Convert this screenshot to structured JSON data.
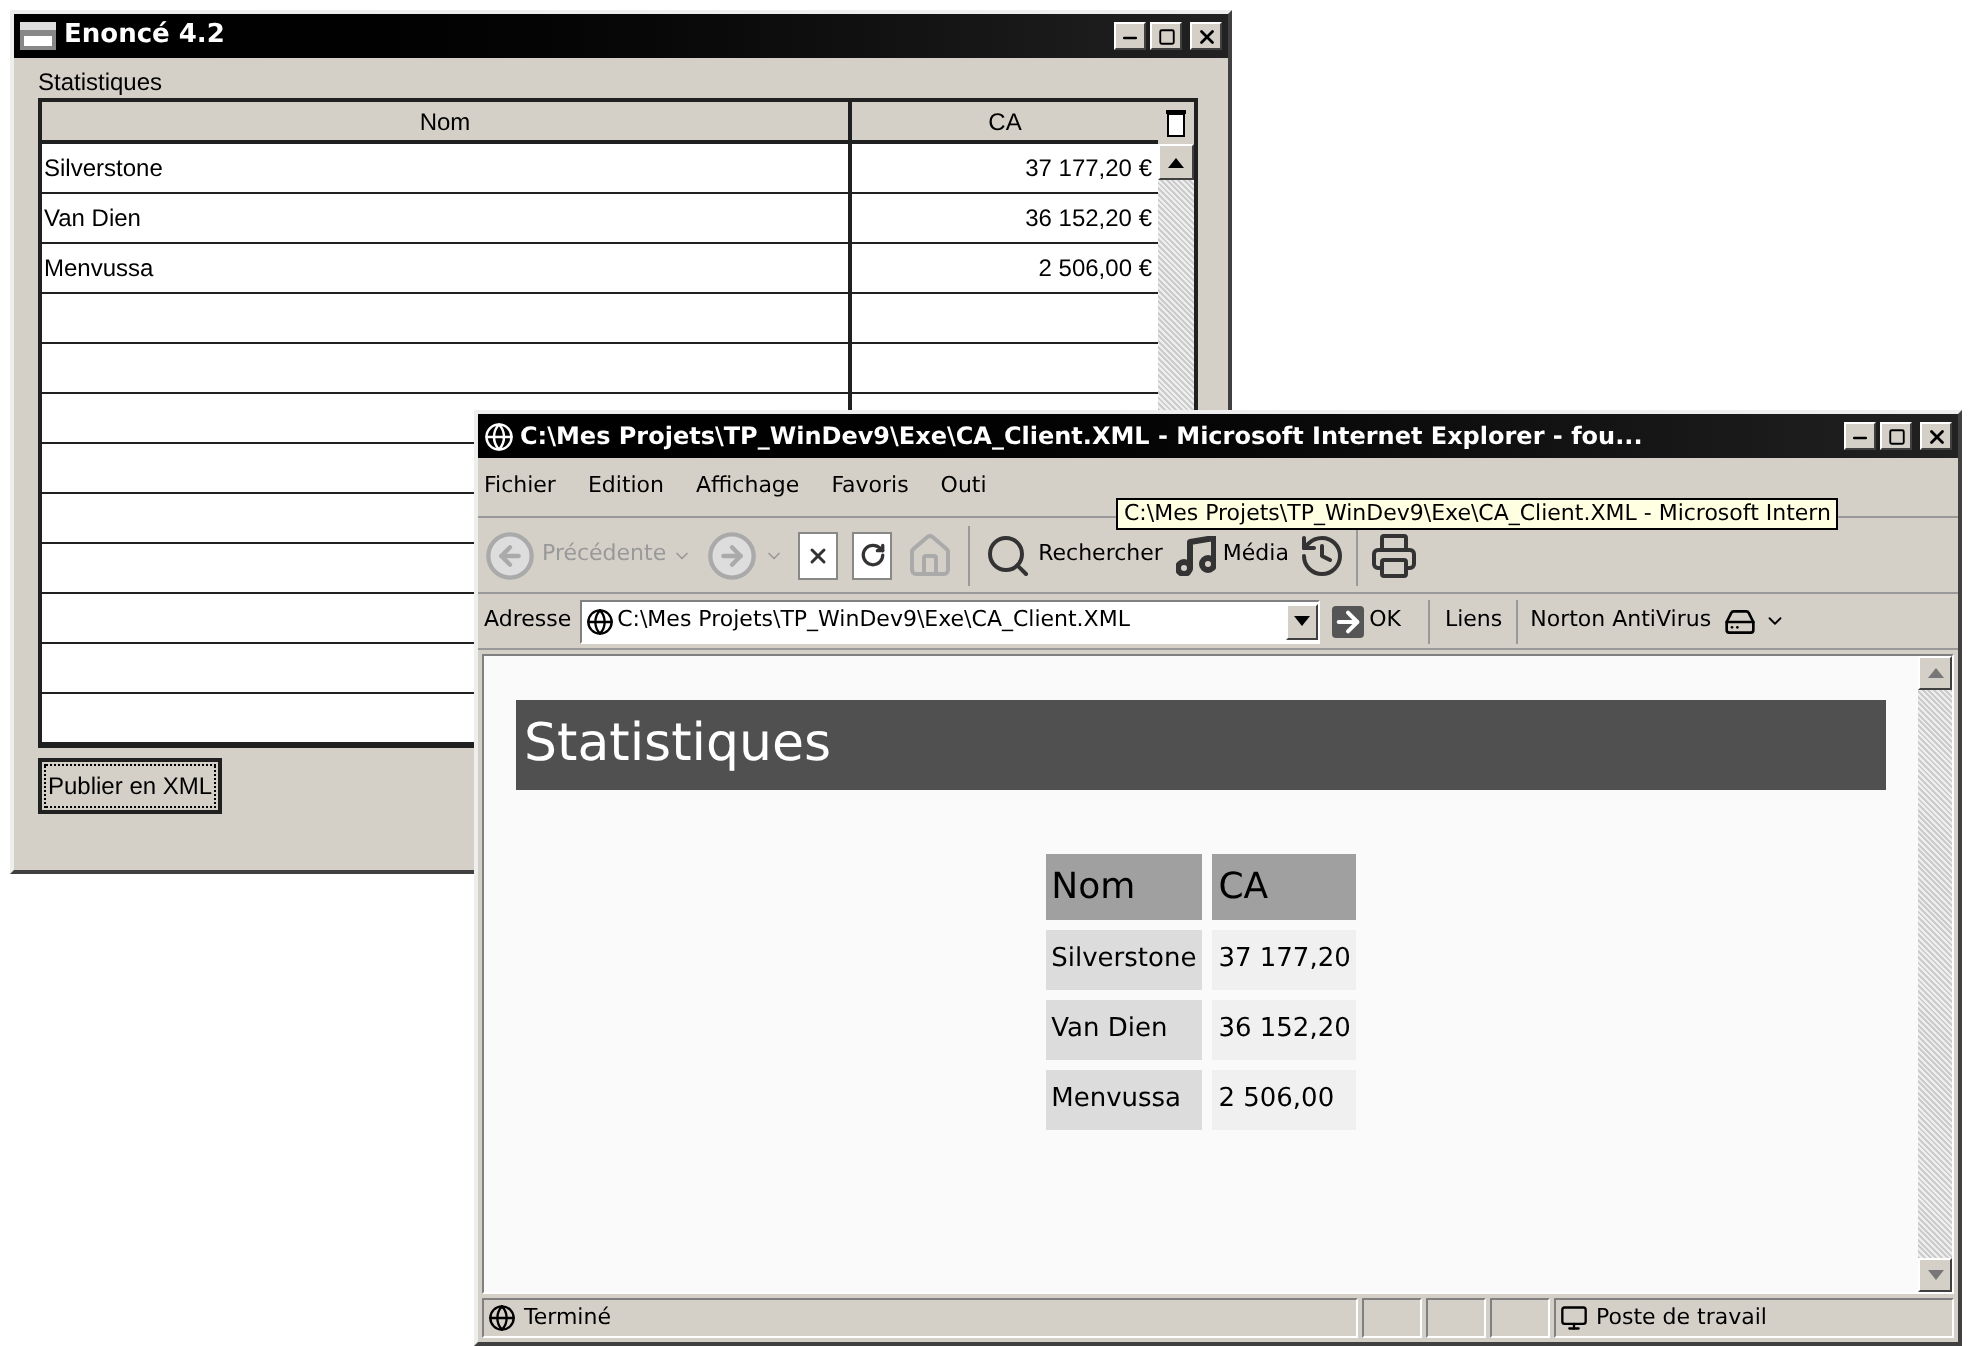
{
  "window_1": {
    "title": "Enoncé 4.2",
    "group_label": "Statistiques",
    "table": {
      "columns": [
        "Nom",
        "CA"
      ],
      "rows": [
        {
          "nom": "Silverstone",
          "ca": "37 177,20 €"
        },
        {
          "nom": "Van Dien",
          "ca": "36 152,20 €"
        },
        {
          "nom": "Menvussa",
          "ca": "2 506,00 €"
        }
      ]
    },
    "button": "Publier en XML"
  },
  "window_2": {
    "title": "C:\\Mes Projets\\TP_WinDev9\\Exe\\CA_Client.XML - Microsoft Internet Explorer - fou...",
    "menu": [
      "Fichier",
      "Edition",
      "Affichage",
      "Favoris",
      "Outi"
    ],
    "tooltip": "C:\\Mes Projets\\TP_WinDev9\\Exe\\CA_Client.XML - Microsoft Intern",
    "toolbar": [
      {
        "kind": "back",
        "label": "Précédente",
        "disabled": true
      },
      {
        "kind": "forward",
        "disabled": true
      },
      {
        "kind": "stop",
        "disabled": false
      },
      {
        "kind": "refresh",
        "disabled": false
      },
      {
        "kind": "home",
        "disabled": true
      },
      {
        "kind": "search",
        "label": "Rechercher",
        "disabled": false
      },
      {
        "kind": "media",
        "label": "Média",
        "disabled": false
      },
      {
        "kind": "history",
        "disabled": false
      },
      {
        "kind": "print",
        "disabled": false
      }
    ],
    "address": {
      "label": "Adresse",
      "value": "C:\\Mes Projets\\TP_WinDev9\\Exe\\CA_Client.XML",
      "go": "OK",
      "links": "Liens",
      "extension": "Norton AntiVirus"
    },
    "page": {
      "heading": "Statistiques",
      "table": {
        "columns": [
          "Nom",
          "CA"
        ],
        "rows": [
          {
            "nom": "Silverstone",
            "ca": "37 177,20"
          },
          {
            "nom": "Van Dien",
            "ca": "36 152,20"
          },
          {
            "nom": "Menvussa",
            "ca": "2 506,00"
          }
        ]
      }
    },
    "status_bar": {
      "text": "Terminé",
      "zone": "Poste de travail"
    }
  }
}
